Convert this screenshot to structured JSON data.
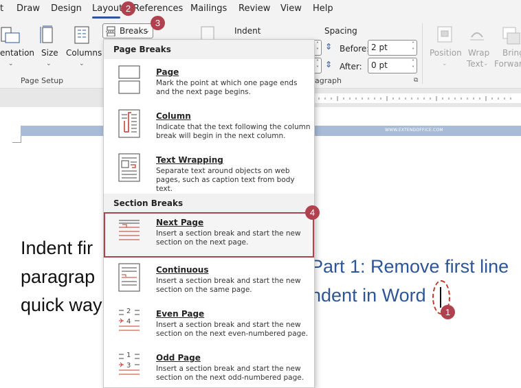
{
  "menu": {
    "items": [
      "t",
      "Draw",
      "Design",
      "Layout",
      "References",
      "Mailings",
      "Review",
      "View",
      "Help"
    ]
  },
  "ribbon": {
    "orientation": "entation",
    "size": "Size",
    "columns": "Columns",
    "breaks": "Breaks",
    "page_setup": "Page Setup",
    "indent": "Indent",
    "spacing": "Spacing",
    "before_label": "Before:",
    "before_value": "2 pt",
    "after_label": "After:",
    "after_value": "0 pt",
    "paragraph": "agraph",
    "position": "Position",
    "wrap": "Wrap",
    "wrap_text": "Text",
    "bring": "Bring",
    "forward": "Forwar"
  },
  "document": {
    "band_text": "WWW.EXTENDOFFICE.COM",
    "line1": "Indent fir",
    "line2": "paragrap",
    "line3": "quick way",
    "heading_line1": "Part 1: Remove first line",
    "heading_line2": "ndent in Word"
  },
  "badges": [
    "1",
    "2",
    "3",
    "4"
  ],
  "breaks_menu": {
    "page_breaks_header": "Page Breaks",
    "section_breaks_header": "Section Breaks",
    "items": [
      {
        "title": "Page",
        "desc": "Mark the point at which one page ends and the next page begins."
      },
      {
        "title": "Column",
        "desc": "Indicate that the text following the column break will begin in the next column."
      },
      {
        "title": "Text Wrapping",
        "desc": "Separate text around objects on web pages, such as caption text from body text."
      },
      {
        "title": "Next Page",
        "desc": "Insert a section break and start the new section on the next page."
      },
      {
        "title": "Continuous",
        "desc": "Insert a section break and start the new section on the same page."
      },
      {
        "title": "Even Page",
        "desc": "Insert a section break and start the new section on the next even-numbered page."
      },
      {
        "title": "Odd Page",
        "desc": "Insert a section break and start the new section on the next odd-numbered page."
      }
    ],
    "icon_marks": {
      "even_top": "2",
      "even_bottom": "4",
      "odd_top": "1",
      "odd_bottom": "3"
    }
  },
  "colors": {
    "accent": "#2b579a",
    "badge": "#b0414e",
    "heading": "#2e5597"
  }
}
